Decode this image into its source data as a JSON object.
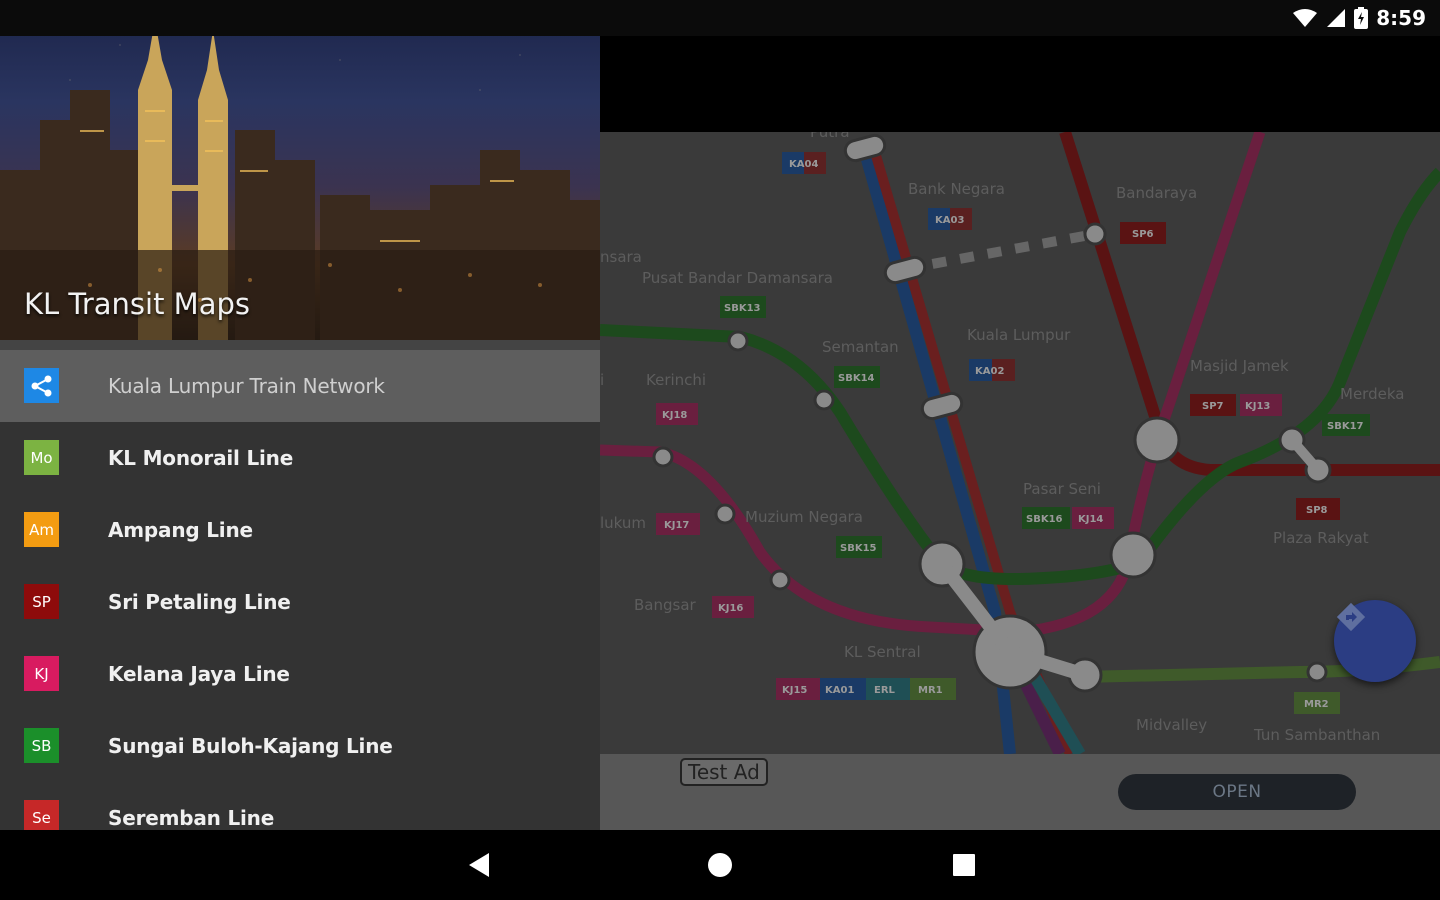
{
  "status_bar": {
    "time": "8:59",
    "icons": [
      "wifi-icon",
      "signal-icon",
      "battery-icon"
    ]
  },
  "drawer": {
    "title": "KL Transit Maps",
    "items": [
      {
        "label": "Kuala Lumpur Train Network",
        "badge": "",
        "icon": "share-network-icon",
        "color": "#1e88e5",
        "active": true
      },
      {
        "label": "KL Monorail Line",
        "badge": "Mo",
        "color": "#7cb342"
      },
      {
        "label": "Ampang Line",
        "badge": "Am",
        "color": "#f39c12"
      },
      {
        "label": "Sri Petaling Line",
        "badge": "SP",
        "color": "#8e0b0b"
      },
      {
        "label": "Kelana Jaya Line",
        "badge": "KJ",
        "color": "#d81b60"
      },
      {
        "label": "Sungai Buloh-Kajang Line",
        "badge": "SB",
        "color": "#1b8f2a"
      },
      {
        "label": "Seremban Line",
        "badge": "Se",
        "color": "#c62828"
      }
    ]
  },
  "map": {
    "stations": [
      {
        "name": "Bank Negara",
        "tags": [
          "KA03"
        ]
      },
      {
        "name": "Bandaraya",
        "tags": [
          "SP6"
        ]
      },
      {
        "name": "Pusat Bandar Damansara",
        "tags": [
          "SBK13"
        ]
      },
      {
        "name": "Semantan",
        "tags": [
          "SBK14"
        ]
      },
      {
        "name": "Kuala Lumpur",
        "tags": [
          "KA02"
        ]
      },
      {
        "name": "Masjid Jamek",
        "tags": [
          "SP7",
          "KJ13"
        ]
      },
      {
        "name": "Merdeka",
        "tags": [
          "SBK17"
        ]
      },
      {
        "name": "Kerinchi",
        "tags": [
          "KJ18"
        ]
      },
      {
        "name": "Pasar Seni",
        "tags": [
          "SBK16",
          "KJ14"
        ]
      },
      {
        "name": "Muzium Negara",
        "tags": [
          "SBK15"
        ]
      },
      {
        "name": "Plaza Rakyat",
        "tags": [
          "SP8"
        ]
      },
      {
        "name": "Bangsar",
        "tags": [
          "KJ16"
        ]
      },
      {
        "name": "KL Sentral",
        "tags": [
          "KJ15",
          "KA01",
          "ERL",
          "MR1"
        ]
      },
      {
        "name": "Midvalley",
        "tags": []
      },
      {
        "name": "Tun Sambanthan",
        "tags": [
          "MR2"
        ]
      }
    ],
    "partial_labels": [
      "Putra",
      "nsara",
      "lukum",
      "i"
    ],
    "partial_tags": [
      "KA04",
      "KJ17"
    ]
  },
  "ad": {
    "label": "Test Ad",
    "button": "OPEN"
  },
  "nav": {
    "icons": [
      "back-icon",
      "home-icon",
      "recents-icon"
    ]
  }
}
